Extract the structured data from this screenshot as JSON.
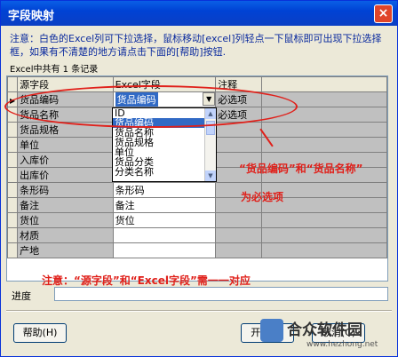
{
  "window": {
    "title": "字段映射",
    "close_label": "×"
  },
  "notice": "注意：白色的Excel列可下拉选择，鼠标移动[excel]列轻点一下鼠标即可出现下拉选择框，如果有不清楚的地方请点击下面的[帮助]按钮.",
  "record_count": "Excel中共有 1 条记录",
  "grid": {
    "headers": [
      "源字段",
      "Excel字段",
      "注释"
    ],
    "rows": [
      {
        "src": "货品编码",
        "excel": "货品编码",
        "note": "必选项"
      },
      {
        "src": "货品名称",
        "excel": "",
        "note": "必选项"
      },
      {
        "src": "货品规格",
        "excel": "",
        "note": ""
      },
      {
        "src": "单位",
        "excel": "",
        "note": ""
      },
      {
        "src": "入库价",
        "excel": "",
        "note": ""
      },
      {
        "src": "出库价",
        "excel": "",
        "note": ""
      },
      {
        "src": "条形码",
        "excel": "条形码",
        "note": ""
      },
      {
        "src": "备注",
        "excel": "备注",
        "note": ""
      },
      {
        "src": "货位",
        "excel": "货位",
        "note": ""
      },
      {
        "src": "材质",
        "excel": "",
        "note": ""
      },
      {
        "src": "产地",
        "excel": "",
        "note": ""
      }
    ]
  },
  "dropdown": {
    "items": [
      "ID",
      "货品编码",
      "货品名称",
      "货品规格",
      "单位",
      "货品分类",
      "分类名称"
    ],
    "selected_index": 1
  },
  "annotations": {
    "required_fields": "“货品编码”和“货品名称”",
    "required_suffix": "为必选项",
    "correspondence": "注意：“源字段”和“Excel字段”需一一对应"
  },
  "progress": {
    "label": "进度",
    "value": 0
  },
  "buttons": {
    "help": "帮助(H)",
    "start": "开始(S)",
    "cancel": "取消(C)"
  },
  "watermark": {
    "brand": "合众软件园",
    "url": "www.hezhong.net"
  },
  "colors": {
    "title_bar": "#0042d4",
    "annotation": "#e0201a",
    "selection": "#316ac5",
    "grid_gray": "#c0c0c0"
  }
}
